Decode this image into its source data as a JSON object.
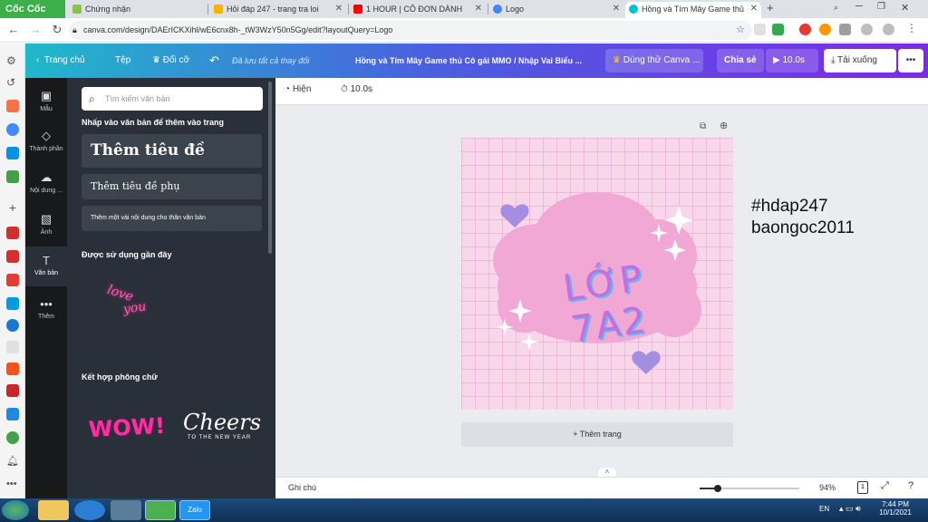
{
  "browser": {
    "brand": "Cốc Cốc",
    "tabs": [
      {
        "label": "Chứng nhận",
        "fav": "#8bc34a"
      },
      {
        "label": "Hỏi đáp 247 - trang tra loi",
        "fav": "#f4b400"
      },
      {
        "label": "1 HOUR | CÔ ĐƠN DÀNH",
        "fav": "#ff0000"
      },
      {
        "label": "Logo",
        "fav": "#4285f4"
      },
      {
        "label": "Hồng và Tím Mây Game thủ",
        "fav": "#00c4cc"
      }
    ],
    "url": "canva.com/design/DAErICKXihl/wE6cnx8h-_tW3WzY50n5Gg/edit?layoutQuery=Logo"
  },
  "header": {
    "home": "Trang chủ",
    "file": "Tệp",
    "resize": "Đổi cỡ",
    "saved_status": "Đã lưu tất cả thay đổi",
    "design_title": "Hồng và Tím Mây Game thủ Cô gái MMO / Nhập Vai Biểu ...",
    "try_pro": "Dùng thử Canva ...",
    "share": "Chia sẻ",
    "play_duration": "10.0s",
    "download": "Tải xuống",
    "more": "•••"
  },
  "rail": [
    {
      "label": "Mẫu",
      "icon": "▣"
    },
    {
      "label": "Thành phần",
      "icon": "◇"
    },
    {
      "label": "Nội dung ...",
      "icon": "☁"
    },
    {
      "label": "Ảnh",
      "icon": "▧"
    },
    {
      "label": "Văn bản",
      "icon": "T"
    },
    {
      "label": "Thêm",
      "icon": "•••"
    }
  ],
  "panel": {
    "search_placeholder": "Tìm kiếm văn bản",
    "hint": "Nhấp vào văn bản để thêm vào trang",
    "add_heading": "Thêm tiêu đề",
    "add_subheading": "Thêm tiêu đề phụ",
    "add_body": "Thêm một vài nội dung cho thân văn bản",
    "recent_label": "Được sử dụng gần đây",
    "recent_sample_1": "love",
    "recent_sample_2": "you",
    "combo_label": "Kết hợp phông chữ",
    "combo_1": "WOW!",
    "combo_2": "Cheers",
    "combo_2_sub": "TO THE NEW YEAR"
  },
  "editor": {
    "toolbar_show": "Hiện",
    "toolbar_duration": "10.0s",
    "design_text": "LỚP 7A2",
    "overlay_line1": "#hdap247",
    "overlay_line2": "baongoc2011",
    "add_page": "+ Thêm trang",
    "notes": "Ghi chú",
    "zoom": "94%",
    "page_count": "1"
  },
  "taskbar": {
    "lang": "EN",
    "time": "7:44 PM",
    "date": "10/1/2021"
  },
  "colors": {
    "canva_teal": "#20b9c9",
    "canva_purple": "#7d2ae8",
    "panel_bg": "#293039",
    "design_bg": "#f9d7ea",
    "cloud": "#f0a7d2",
    "heart": "#a48ee0"
  }
}
